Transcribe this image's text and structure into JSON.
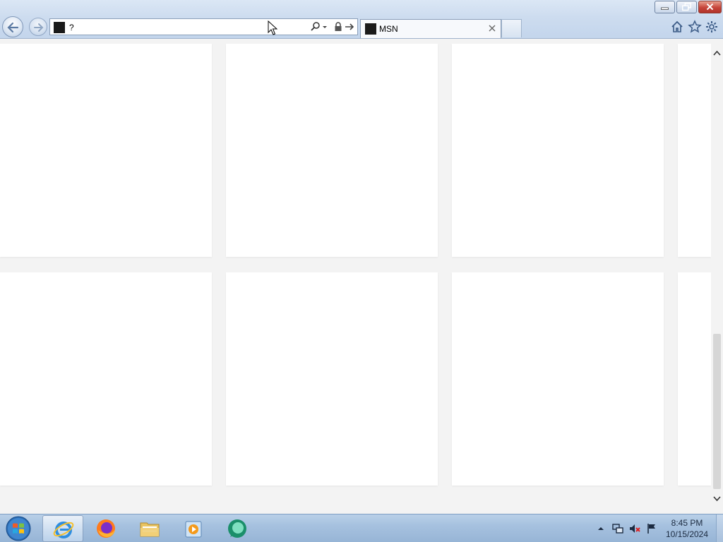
{
  "browser": {
    "address": {
      "value": "?"
    },
    "tab": {
      "title": "MSN"
    }
  },
  "content": {
    "cards_count_visible": 8
  },
  "taskbar": {
    "items": [
      "start",
      "internet-explorer",
      "firefox",
      "file-explorer",
      "media-player",
      "app-green"
    ],
    "active_item": "internet-explorer",
    "clock": {
      "time": "8:45 PM",
      "date": "10/15/2024"
    }
  },
  "colors": {
    "chrome_bg": "#cddcef",
    "page_bg": "#f3f3f3",
    "card_bg": "#ffffff",
    "close_red": "#c6453a"
  }
}
